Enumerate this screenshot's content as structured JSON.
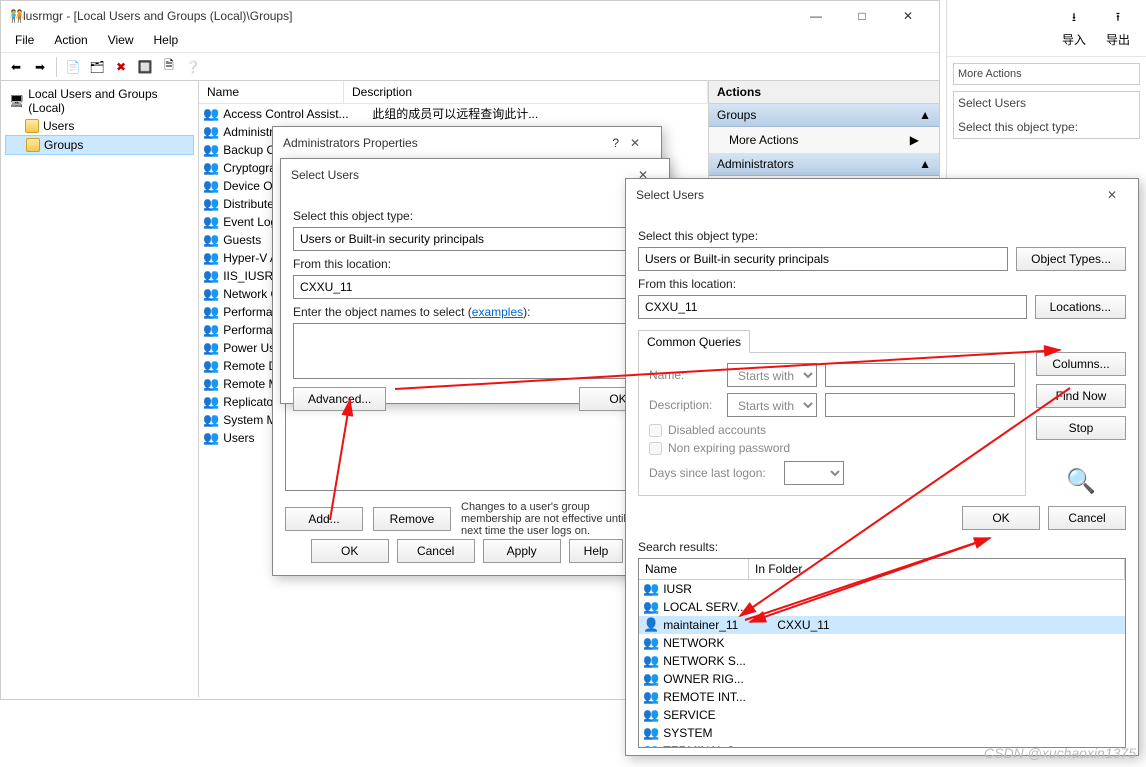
{
  "main": {
    "title": "lusrmgr - [Local Users and Groups (Local)\\Groups]",
    "menu": {
      "file": "File",
      "action": "Action",
      "view": "View",
      "help": "Help"
    },
    "tree": {
      "root": "Local Users and Groups (Local)",
      "users": "Users",
      "groups": "Groups"
    },
    "columns": {
      "name": "Name",
      "description": "Description"
    },
    "groups": [
      {
        "name": "Access Control Assist...",
        "desc": "此组的成员可以远程查询此计..."
      },
      {
        "name": "Administrators",
        "desc": ""
      },
      {
        "name": "Backup Op",
        "desc": ""
      },
      {
        "name": "Cryptogra",
        "desc": ""
      },
      {
        "name": "Device Ov",
        "desc": ""
      },
      {
        "name": "Distribute",
        "desc": ""
      },
      {
        "name": "Event Log",
        "desc": ""
      },
      {
        "name": "Guests",
        "desc": ""
      },
      {
        "name": "Hyper-V A",
        "desc": ""
      },
      {
        "name": "IIS_IUSRS",
        "desc": ""
      },
      {
        "name": "Network C",
        "desc": ""
      },
      {
        "name": "Performa",
        "desc": ""
      },
      {
        "name": "Performa",
        "desc": ""
      },
      {
        "name": "Power Us",
        "desc": ""
      },
      {
        "name": "Remote D",
        "desc": ""
      },
      {
        "name": "Remote M",
        "desc": ""
      },
      {
        "name": "Replicator",
        "desc": ""
      },
      {
        "name": "System M",
        "desc": ""
      },
      {
        "name": "Users",
        "desc": ""
      }
    ],
    "actions": {
      "header": "Actions",
      "section1": "Groups",
      "more": "More Actions",
      "section2": "Administrators"
    }
  },
  "bg_right": {
    "import": "导入",
    "export": "导出",
    "more_actions": "More Actions",
    "select_users": "Select Users",
    "select_object_type": "Select this object type:"
  },
  "props_dialog": {
    "title": "Administrators Properties",
    "add": "Add...",
    "remove": "Remove",
    "note": "Changes to a user's group membership are not effective until the next time the user logs on.",
    "ok": "OK",
    "cancel": "Cancel",
    "apply": "Apply",
    "help": "Help"
  },
  "select1": {
    "title": "Select Users",
    "object_type_label": "Select this object type:",
    "object_type": "Users or Built-in security principals",
    "location_label": "From this location:",
    "location": "CXXU_11",
    "names_label": "Enter the object names to select",
    "examples": "examples",
    "advanced": "Advanced...",
    "ok": "OK"
  },
  "select2": {
    "title": "Select Users",
    "object_type_label": "Select this object type:",
    "object_type": "Users or Built-in security principals",
    "object_types_btn": "Object Types...",
    "location_label": "From this location:",
    "location": "CXXU_11",
    "locations_btn": "Locations...",
    "common_queries": "Common Queries",
    "name_label": "Name:",
    "starts_with": "Starts with",
    "desc_label": "Description:",
    "disabled": "Disabled accounts",
    "nonexpiring": "Non expiring password",
    "days_since": "Days since last logon:",
    "columns_btn": "Columns...",
    "find_now": "Find Now",
    "stop": "Stop",
    "ok": "OK",
    "cancel": "Cancel",
    "search_results": "Search results:",
    "col_name": "Name",
    "col_folder": "In Folder",
    "results": [
      {
        "name": "IUSR",
        "folder": "",
        "type": "group"
      },
      {
        "name": "LOCAL SERV...",
        "folder": "",
        "type": "group"
      },
      {
        "name": "maintainer_11",
        "folder": "CXXU_11",
        "type": "user",
        "selected": true
      },
      {
        "name": "NETWORK",
        "folder": "",
        "type": "group"
      },
      {
        "name": "NETWORK S...",
        "folder": "",
        "type": "group"
      },
      {
        "name": "OWNER RIG...",
        "folder": "",
        "type": "group"
      },
      {
        "name": "REMOTE INT...",
        "folder": "",
        "type": "group"
      },
      {
        "name": "SERVICE",
        "folder": "",
        "type": "group"
      },
      {
        "name": "SYSTEM",
        "folder": "",
        "type": "group"
      },
      {
        "name": "TERMINAL S...",
        "folder": "",
        "type": "group"
      }
    ]
  },
  "watermark": "CSDN @xuchaoxin1375"
}
